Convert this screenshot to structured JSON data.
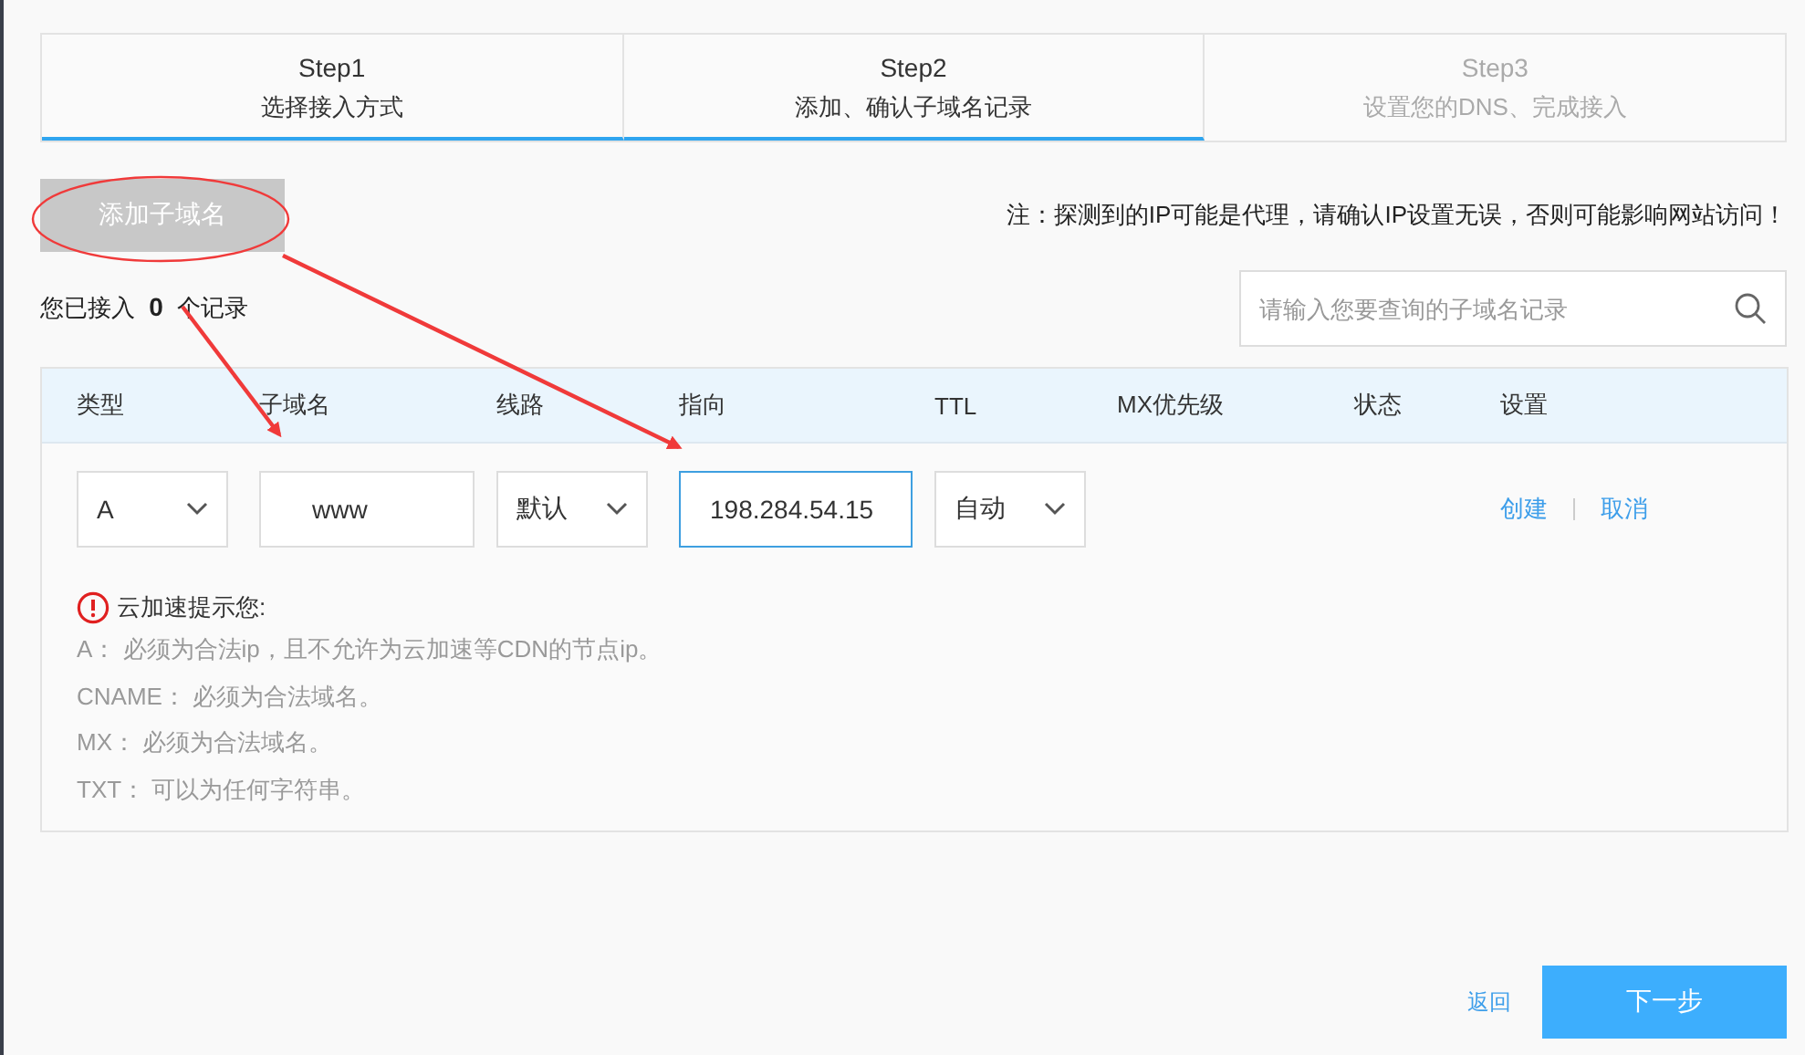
{
  "steps": [
    {
      "title": "Step1",
      "subtitle": "选择接入方式",
      "active": true
    },
    {
      "title": "Step2",
      "subtitle": "添加、确认子域名记录",
      "active": true
    },
    {
      "title": "Step3",
      "subtitle": "设置您的DNS、完成接入",
      "active": false
    }
  ],
  "add_button": {
    "label": "添加子域名",
    "disabled": true
  },
  "note": "注：探测到的IP可能是代理，请确认IP设置无误，否则可能影响网站访问！",
  "record_count": "您已接入 **0** 个记录",
  "search": {
    "placeholder": "请输入您要查询的子域名记录"
  },
  "table": {
    "columns": [
      "类型",
      "子域名",
      "线路",
      "指向",
      "TTL",
      "MX优先级",
      "状态",
      "设置"
    ],
    "edit_row": [
      {
        "kind": "select",
        "value": "A",
        "focused": false
      },
      {
        "kind": "input",
        "value": "www",
        "focused": false
      },
      {
        "kind": "select",
        "value": "默认",
        "focused": false
      },
      {
        "kind": "input",
        "value": "198.284.54.15",
        "focused": true
      },
      {
        "kind": "select",
        "value": "自动",
        "focused": false
      }
    ],
    "actions": [
      "创建",
      "取消"
    ]
  },
  "tips": {
    "title": "云加速提示您:",
    "lines": [
      "A： 必须为合法ip，且不允许为云加速等CDN的节点ip。",
      "CNAME： 必须为合法域名。",
      "MX： 必须为合法域名。",
      "TXT： 可以为任何字符串。"
    ]
  },
  "footer": {
    "back": "返回",
    "next": "下一步"
  }
}
